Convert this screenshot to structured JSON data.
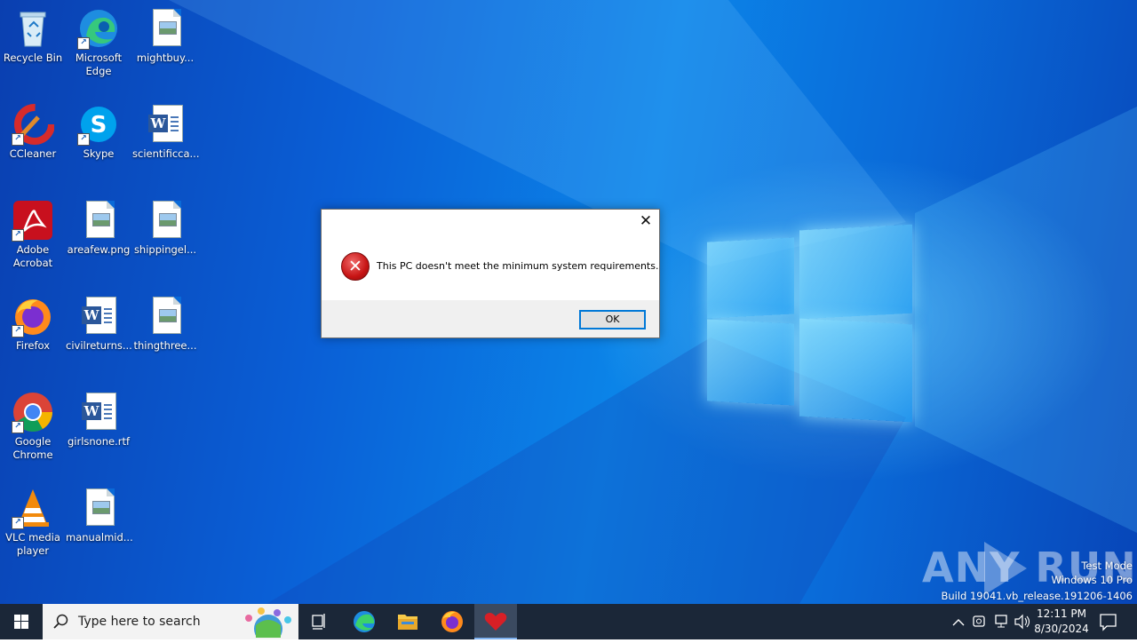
{
  "desktop_icons": [
    {
      "label": "Recycle Bin",
      "icon": "recycle-bin-icon"
    },
    {
      "label": "Microsoft Edge",
      "icon": "edge-icon"
    },
    {
      "label": "mightbuy...",
      "icon": "image-file-icon"
    },
    {
      "label": "CCleaner",
      "icon": "ccleaner-icon"
    },
    {
      "label": "Skype",
      "icon": "skype-icon"
    },
    {
      "label": "scientificca...",
      "icon": "word-document-icon"
    },
    {
      "label": "Adobe Acrobat",
      "icon": "acrobat-icon"
    },
    {
      "label": "areafew.png",
      "icon": "image-file-icon"
    },
    {
      "label": "shippingel...",
      "icon": "image-file-icon"
    },
    {
      "label": "Firefox",
      "icon": "firefox-icon"
    },
    {
      "label": "civilreturns...",
      "icon": "word-document-icon"
    },
    {
      "label": "thingthree...",
      "icon": "image-file-icon"
    },
    {
      "label": "Google Chrome",
      "icon": "chrome-icon"
    },
    {
      "label": "girlsnone.rtf",
      "icon": "word-document-icon"
    },
    {
      "label": "VLC media player",
      "icon": "vlc-icon"
    },
    {
      "label": "manualmid...",
      "icon": "image-file-icon"
    }
  ],
  "dialog": {
    "message": "This PC doesn't meet the minimum system requirements.",
    "ok_label": "OK",
    "close_glyph": "✕",
    "icon": "error-icon"
  },
  "watermark": {
    "brand": "ANY RUN",
    "line1": "Test Mode",
    "line2": "Windows 10 Pro",
    "line3": "Build 19041.vb_release.191206-1406"
  },
  "taskbar": {
    "search_placeholder": "Type here to search",
    "pinned": [
      "task-view-icon",
      "edge-icon",
      "file-explorer-icon",
      "firefox-icon",
      "heart-app-icon"
    ],
    "time": "12:11 PM",
    "date": "8/30/2024"
  },
  "colors": {
    "accent": "#0078d7",
    "error": "#c71414",
    "taskbar": "#1b2738"
  }
}
